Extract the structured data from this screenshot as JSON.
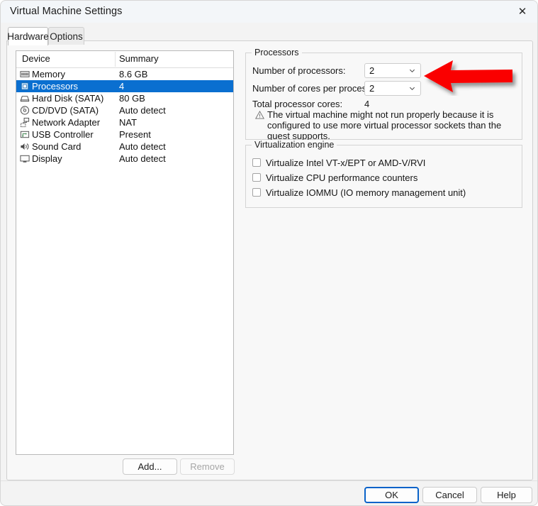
{
  "window": {
    "title": "Virtual Machine Settings",
    "close_icon": "close-icon"
  },
  "tabs": [
    {
      "label": "Hardware",
      "selected": true
    },
    {
      "label": "Options",
      "selected": false
    }
  ],
  "device_list": {
    "columns": [
      "Device",
      "Summary"
    ],
    "rows": [
      {
        "icon": "memory-icon",
        "device": "Memory",
        "summary": "8.6 GB",
        "selected": false
      },
      {
        "icon": "processor-icon",
        "device": "Processors",
        "summary": "4",
        "selected": true
      },
      {
        "icon": "hard-disk-icon",
        "device": "Hard Disk (SATA)",
        "summary": "80 GB",
        "selected": false
      },
      {
        "icon": "cd-dvd-icon",
        "device": "CD/DVD (SATA)",
        "summary": "Auto detect",
        "selected": false
      },
      {
        "icon": "network-adapter-icon",
        "device": "Network Adapter",
        "summary": "NAT",
        "selected": false
      },
      {
        "icon": "usb-controller-icon",
        "device": "USB Controller",
        "summary": "Present",
        "selected": false
      },
      {
        "icon": "sound-card-icon",
        "device": "Sound Card",
        "summary": "Auto detect",
        "selected": false
      },
      {
        "icon": "display-icon",
        "device": "Display",
        "summary": "Auto detect",
        "selected": false
      }
    ],
    "add_label": "Add...",
    "remove_label": "Remove"
  },
  "processors": {
    "group_title": "Processors",
    "num_processors_label": "Number of processors:",
    "num_processors_value": "2",
    "num_cores_label": "Number of cores per processor:",
    "num_cores_value": "2",
    "total_cores_label": "Total processor cores:",
    "total_cores_value": "4",
    "warning_icon": "warning-triangle-icon",
    "warning_text": "The virtual machine might not run properly because it is configured to use more virtual processor sockets than the guest supports."
  },
  "virtualization": {
    "group_title": "Virtualization engine",
    "checkboxes": [
      {
        "label": "Virtualize Intel VT-x/EPT or AMD-V/RVI",
        "checked": false
      },
      {
        "label": "Virtualize CPU performance counters",
        "checked": false
      },
      {
        "label": "Virtualize IOMMU (IO memory management unit)",
        "checked": false
      }
    ]
  },
  "footer": {
    "ok_label": "OK",
    "cancel_label": "Cancel",
    "help_label": "Help"
  },
  "annotation": {
    "arrow_icon": "red-left-arrow-annotation",
    "arrow_color": "#fa0000",
    "points_at": "Number of processors dropdown"
  },
  "colors": {
    "selection_blue": "#0a6fd0",
    "accent_blue": "#0a63c9",
    "arrow_red": "#fa0000",
    "window_bg": "#f3f3f3",
    "panel_bg": "#f8f8f8"
  }
}
